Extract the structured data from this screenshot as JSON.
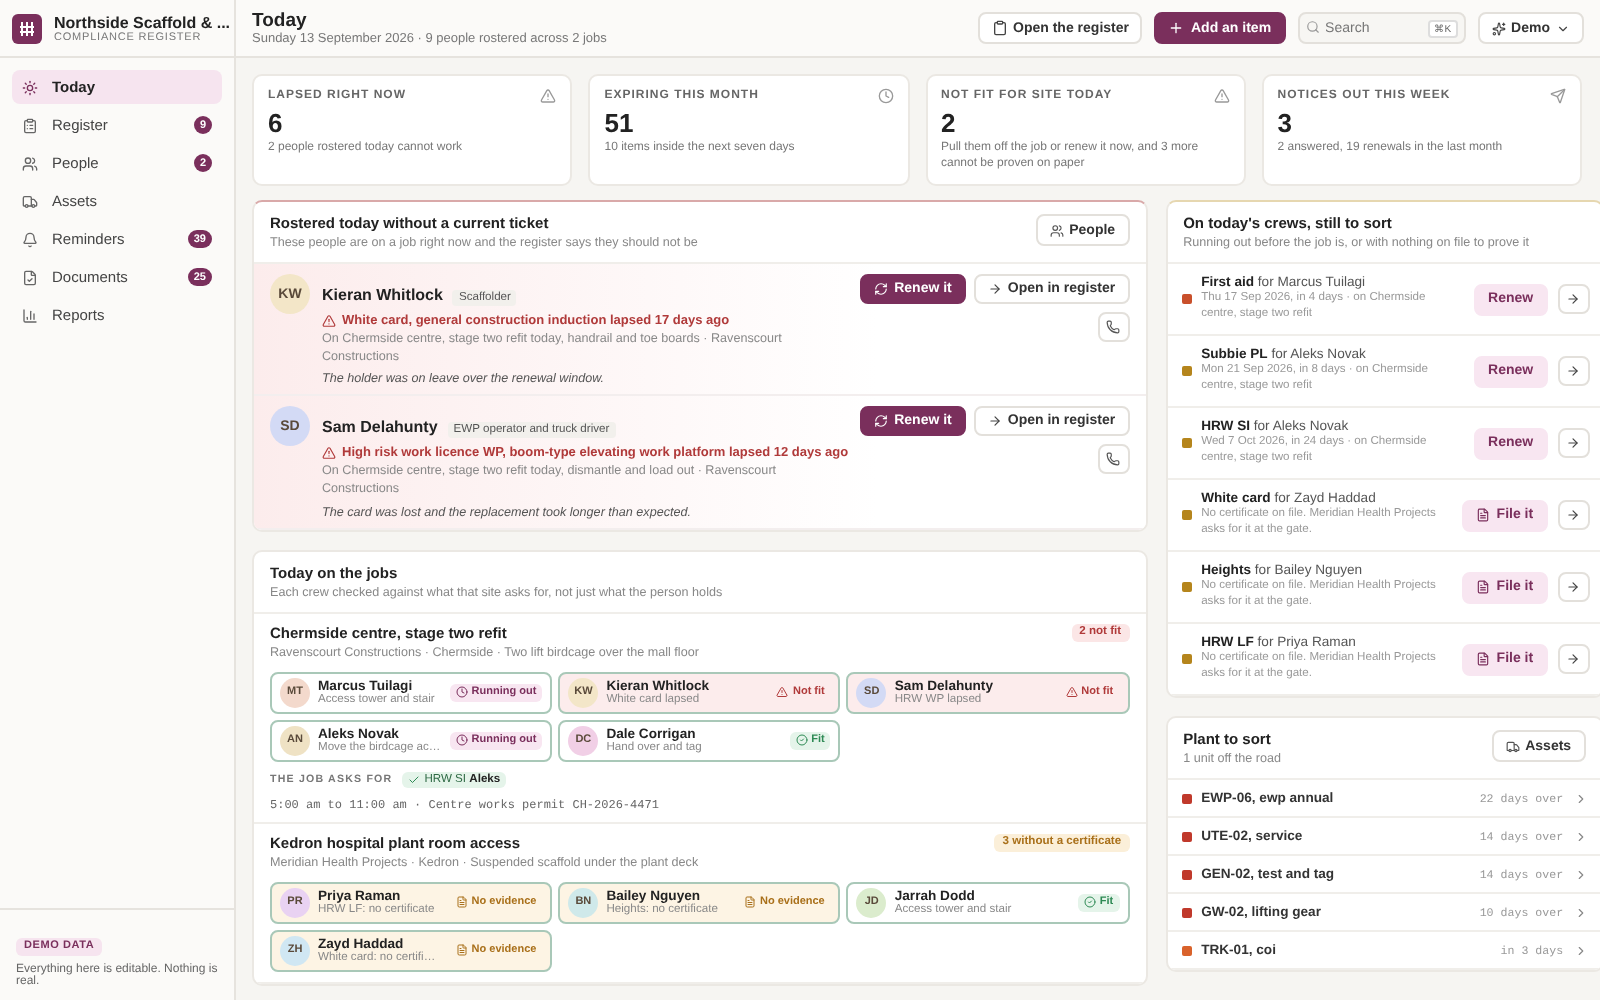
{
  "brand": {
    "name": "Northside Scaffold & ...",
    "subtitle": "COMPLIANCE REGISTER"
  },
  "nav": [
    {
      "label": "Today",
      "selected": true
    },
    {
      "label": "Register",
      "badge": "9",
      "selected": false
    },
    {
      "label": "People",
      "badge": "2",
      "selected": false
    },
    {
      "label": "Assets",
      "selected": false
    },
    {
      "label": "Reminders",
      "badge": "39",
      "selected": false
    },
    {
      "label": "Documents",
      "badge": "25",
      "selected": false
    },
    {
      "label": "Reports",
      "selected": false
    }
  ],
  "demo_note": {
    "badge": "DEMO DATA",
    "text": "Everything here is editable. Nothing is real."
  },
  "header": {
    "title": "Today",
    "subtitle": "Sunday 13 September 2026 · 9 people rostered across 2 jobs",
    "open_button": "Open the register",
    "add_button": "Add an item",
    "search": {
      "placeholder": "Search",
      "shortcut": "⌘K"
    },
    "demo_menu": "Demo"
  },
  "stats": [
    {
      "label": "LAPSED RIGHT NOW",
      "value": "6",
      "note": "2 people rostered today cannot work"
    },
    {
      "label": "EXPIRING THIS MONTH",
      "value": "51",
      "note": "10 items inside the next seven days"
    },
    {
      "label": "NOT FIT FOR SITE TODAY",
      "value": "2",
      "note": "Pull them off the job or renew it now, and 3 more cannot be proven on paper"
    },
    {
      "label": "NOTICES OUT THIS WEEK",
      "value": "3",
      "note": "2 answered, 19 renewals in the last month"
    }
  ],
  "rostered": {
    "title": "Rostered today without a current ticket",
    "subtitle": "These people are on a job right now and the register says they should not be",
    "button": "People",
    "people": [
      {
        "initials": "KW",
        "color": "#f3e6c8",
        "name": "Kieran Whitlock",
        "role": "Scaffolder",
        "issue": "White card, general construction induction lapsed 17 days ago",
        "detail": "On Chermside centre, stage two refit today, handrail and toe boards · Ravenscourt Constructions",
        "note": "The holder was on leave over the renewal window.",
        "renew": "Renew it",
        "open": "Open in register"
      },
      {
        "initials": "SD",
        "color": "#d3daf5",
        "name": "Sam Delahunty",
        "role": "EWP operator and truck driver",
        "issue": "High risk work licence WP, boom-type elevating work platform lapsed 12 days ago",
        "detail": "On Chermside centre, stage two refit today, dismantle and load out · Ravenscourt Constructions",
        "note": "The card was lost and the replacement took longer than expected.",
        "renew": "Renew it",
        "open": "Open in register"
      }
    ]
  },
  "jobs": {
    "title": "Today on the jobs",
    "subtitle": "Each crew checked against what that site asks for, not just what the person holds",
    "sites": [
      {
        "name": "Chermside centre, stage two refit",
        "meta": "Ravenscourt Constructions · Chermside · Two lift birdcage over the mall floor",
        "badge": "2 not fit",
        "kind": "danger",
        "crew": [
          {
            "initials": "MT",
            "color": "#f3d9cc",
            "name": "Marcus Tuilagi",
            "task": "Access tower and stair",
            "kind": "running",
            "status_label": "Running out"
          },
          {
            "initials": "KW",
            "color": "#f3e6c8",
            "name": "Kieran Whitlock",
            "task": "White card lapsed",
            "kind": "notfit",
            "status_label": "Not fit"
          },
          {
            "initials": "SD",
            "color": "#d3daf5",
            "name": "Sam Delahunty",
            "task": "HRW WP lapsed",
            "kind": "notfit",
            "status_label": "Not fit"
          },
          {
            "initials": "AN",
            "color": "#efe2c4",
            "name": "Aleks Novak",
            "task": "Move the birdcage ac…",
            "kind": "running",
            "status_label": "Running out"
          },
          {
            "initials": "DC",
            "color": "#f1cfe6",
            "name": "Dale Corrigan",
            "task": "Hand over and tag",
            "kind": "fit",
            "status_label": "Fit"
          }
        ],
        "asks": {
          "label": "THE JOB ASKS FOR",
          "items": [
            "HRW SI **Aleks**"
          ]
        },
        "schedule": "5:00 am to 11:00 am · Centre works permit CH-2026-4471"
      },
      {
        "name": "Kedron hospital plant room access",
        "meta": "Meridian Health Projects · Kedron · Suspended scaffold under the plant deck",
        "badge": "3 without a certificate",
        "kind": "warn",
        "crew": [
          {
            "initials": "PR",
            "color": "#e9d2f2",
            "name": "Priya Raman",
            "task": "HRW LF: no certificate",
            "kind": "noevidence",
            "status_label": "No evidence"
          },
          {
            "initials": "BN",
            "color": "#cfe9ea",
            "name": "Bailey Nguyen",
            "task": "Heights: no certificate",
            "kind": "noevidence",
            "status_label": "No evidence"
          },
          {
            "initials": "JD",
            "color": "#dbeccd",
            "name": "Jarrah Dodd",
            "task": "Access tower and stair",
            "kind": "fit",
            "status_label": "Fit"
          },
          {
            "initials": "ZH",
            "color": "#d0e7f3",
            "name": "Zayd Haddad",
            "task": "White card: no certifi…",
            "kind": "noevidence",
            "status_label": "No evidence"
          }
        ]
      }
    ]
  },
  "to_sort": {
    "title": "On today's crews, still to sort",
    "subtitle": "Running out before the job is, or with nothing on file to prove it",
    "items": [
      {
        "text": "**First aid** for Marcus Tuilagi",
        "detail": "Thu 17 Sep 2026, in 4 days · on Chermside centre, stage two refit",
        "color": "#c9502b",
        "kind": "renew",
        "action": "Renew"
      },
      {
        "text": "**Subbie PL** for Aleks Novak",
        "detail": "Mon 21 Sep 2026, in 8 days · on Chermside centre, stage two refit",
        "color": "#b5851c",
        "kind": "renew",
        "action": "Renew"
      },
      {
        "text": "**HRW SI** for Aleks Novak",
        "detail": "Wed 7 Oct 2026, in 24 days · on Chermside centre, stage two refit",
        "color": "#b5851c",
        "kind": "renew",
        "action": "Renew"
      },
      {
        "text": "**White card** for Zayd Haddad",
        "detail": "No certificate on file. Meridian Health Projects asks for it at the gate.",
        "color": "#b5851c",
        "kind": "file",
        "action": "File it"
      },
      {
        "text": "**Heights** for Bailey Nguyen",
        "detail": "No certificate on file. Meridian Health Projects asks for it at the gate.",
        "color": "#b5851c",
        "kind": "file",
        "action": "File it"
      },
      {
        "text": "**HRW LF** for Priya Raman",
        "detail": "No certificate on file. Meridian Health Projects asks for it at the gate.",
        "color": "#b5851c",
        "kind": "file",
        "action": "File it"
      }
    ]
  },
  "plant": {
    "title": "Plant to sort",
    "subtitle": "1 unit off the road",
    "button": "Assets",
    "items": [
      {
        "name": "EWP-06, ewp annual",
        "due": "22 days over",
        "color": "#c0392b"
      },
      {
        "name": "UTE-02, service",
        "due": "14 days over",
        "color": "#c0392b"
      },
      {
        "name": "GEN-02, test and tag",
        "due": "14 days over",
        "color": "#c0392b"
      },
      {
        "name": "GW-02, lifting gear",
        "due": "10 days over",
        "color": "#c0392b"
      },
      {
        "name": "TRK-01, coi",
        "due": "in 3 days",
        "color": "#d9622b"
      }
    ]
  }
}
